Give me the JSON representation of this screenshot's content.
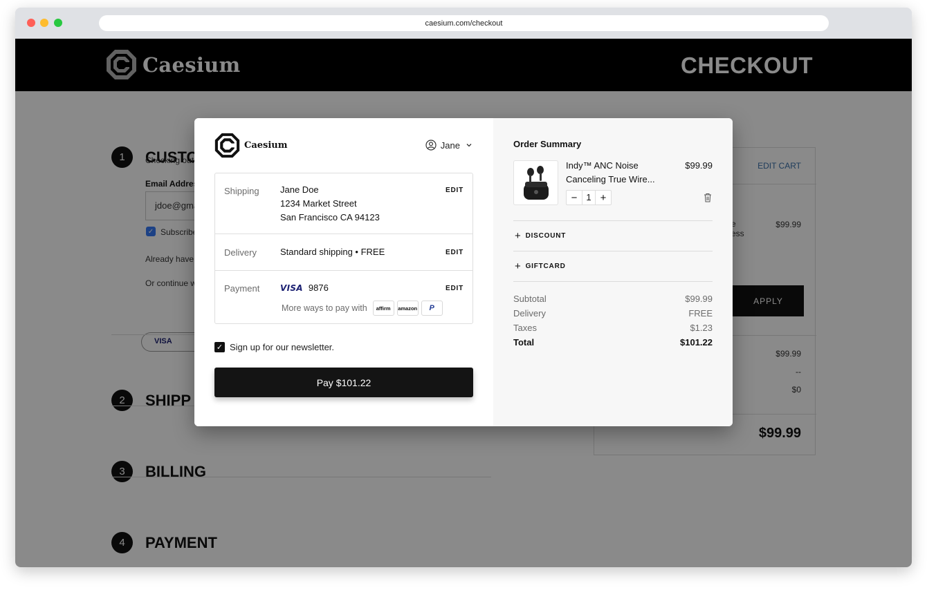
{
  "browser": {
    "url": "caesium.com/checkout"
  },
  "site": {
    "brand": "Caesium",
    "page_title": "CHECKOUT"
  },
  "background": {
    "steps": [
      {
        "num": "1",
        "title": "CUSTO"
      },
      {
        "num": "2",
        "title": "SHIPP"
      },
      {
        "num": "3",
        "title": "BILLING"
      },
      {
        "num": "4",
        "title": "PAYMENT"
      }
    ],
    "checking_out": "Checking out",
    "email_label": "Email Address",
    "email_value": "jdoe@gma",
    "subscribe": "Subscribe",
    "already_have": "Already have",
    "or_continue": "Or continue w",
    "visa": "VISA",
    "cart": {
      "edit_cart": "EDIT CART",
      "item_text_1": "e",
      "item_text_2": "ess",
      "item_price": "$99.99",
      "apply": "APPLY",
      "subtotal": "$99.99",
      "shipping": "--",
      "tax": "$0",
      "total": "$99.99"
    }
  },
  "modal": {
    "brand": "Caesium",
    "user": "Jane",
    "shipping": {
      "label": "Shipping",
      "name": "Jane Doe",
      "street": "1234 Market Street",
      "city": "San Francisco CA 94123",
      "edit": "EDIT"
    },
    "delivery": {
      "label": "Delivery",
      "value": "Standard shipping • FREE",
      "edit": "EDIT"
    },
    "payment": {
      "label": "Payment",
      "card_brand": "VISA",
      "last4": "9876",
      "edit": "EDIT",
      "more_ways": "More ways to pay with",
      "options": [
        "affirm",
        "amazon",
        "P"
      ]
    },
    "newsletter": "Sign up for our newsletter.",
    "pay_button": "Pay $101.22"
  },
  "order_summary": {
    "title": "Order Summary",
    "product": {
      "name": "Indy™ ANC Noise Canceling True Wire...",
      "price": "$99.99",
      "qty": "1"
    },
    "discount": "DISCOUNT",
    "giftcard": "GIFTCARD",
    "rows": [
      {
        "label": "Subtotal",
        "value": "$99.99"
      },
      {
        "label": "Delivery",
        "value": "FREE"
      },
      {
        "label": "Taxes",
        "value": "$1.23"
      }
    ],
    "total": {
      "label": "Total",
      "value": "$101.22"
    }
  }
}
